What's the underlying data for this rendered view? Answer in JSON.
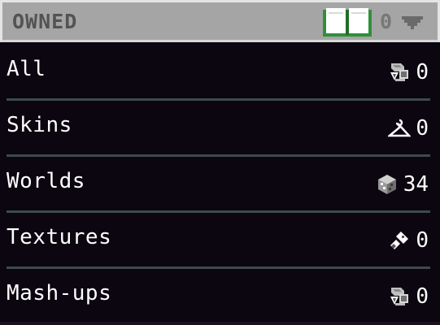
{
  "header": {
    "title": "OWNED",
    "icon": "book-icon",
    "count": "0",
    "dropdown_icon": "chevron-down-icon",
    "colors": {
      "background": "#a5a5a5",
      "border": "#e4e4e4",
      "book": "#2f8f3a"
    }
  },
  "rows": [
    {
      "label": "All",
      "icon": "mixed-content-icon",
      "count": "0"
    },
    {
      "label": "Skins",
      "icon": "hanger-icon",
      "count": "0"
    },
    {
      "label": "Worlds",
      "icon": "world-block-icon",
      "count": "34"
    },
    {
      "label": "Textures",
      "icon": "paintbrush-icon",
      "count": "0"
    },
    {
      "label": "Mash-ups",
      "icon": "mixed-content-icon",
      "count": "0"
    }
  ],
  "colors": {
    "panel_background": "#0b0610",
    "divider": "#3e4a4c",
    "text": "#ffffff"
  }
}
